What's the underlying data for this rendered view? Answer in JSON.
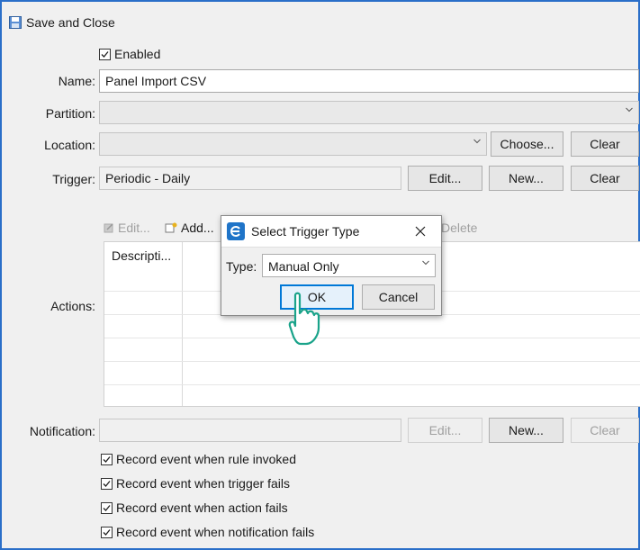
{
  "toolbar": {
    "save_close_label": "Save and Close"
  },
  "form": {
    "enabled_label": "Enabled",
    "name_label": "Name:",
    "name_value": "Panel Import CSV",
    "partition_label": "Partition:",
    "partition_value": "",
    "location_label": "Location:",
    "location_value": "",
    "choose_label": "Choose...",
    "clear_label": "Clear",
    "trigger_label": "Trigger:",
    "trigger_value": "Periodic - Daily",
    "edit_label": "Edit...",
    "new_label": "New...",
    "actions_label": "Actions:",
    "actions_toolbar": {
      "edit": "Edit...",
      "add": "Add...",
      "delete": "Delete"
    },
    "actions_column": "Descripti...",
    "notification_label": "Notification:",
    "notification_value": "",
    "checkboxes": [
      {
        "label": "Record event when rule invoked",
        "checked": true
      },
      {
        "label": "Record event when trigger fails",
        "checked": true
      },
      {
        "label": "Record event when action fails",
        "checked": true
      },
      {
        "label": "Record event when notification fails",
        "checked": true
      }
    ]
  },
  "dialog": {
    "title": "Select Trigger Type",
    "type_label": "Type:",
    "type_value": "Manual Only",
    "ok_label": "OK",
    "cancel_label": "Cancel"
  },
  "colors": {
    "frame_border": "#2a6fc9",
    "accent": "#0078d7",
    "cursor": "#1aa38a"
  }
}
